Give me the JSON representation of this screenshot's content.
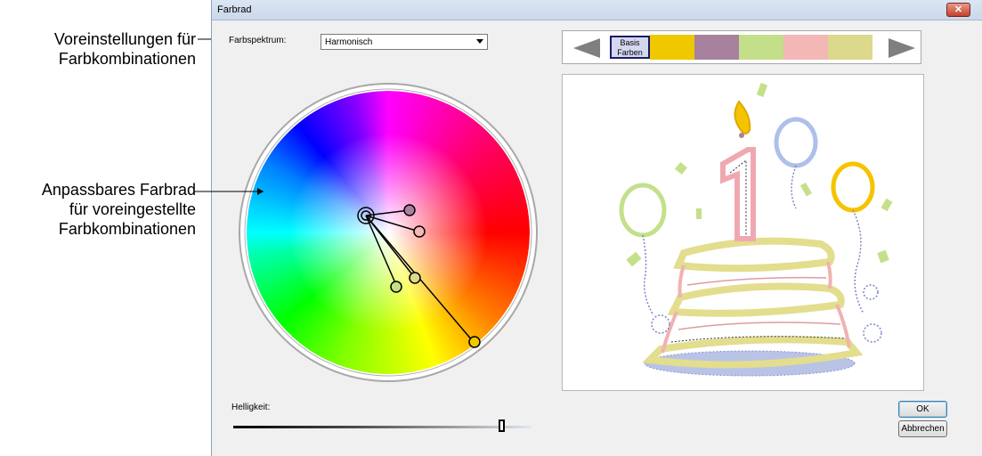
{
  "callouts": {
    "presets_line1": "Voreinstellungen für",
    "presets_line2": "Farbkombinationen",
    "wheel_line1": "Anpassbares Farbrad",
    "wheel_line2": "für voreingestellte",
    "wheel_line3": "Farbkombinationen"
  },
  "dialog": {
    "title": "Farbrad",
    "close_symbol": "✕",
    "spectrum_label": "Farbspektrum:",
    "spectrum_value": "Harmonisch",
    "brightness_label": "Helligkeit:",
    "brightness_level": 0.9,
    "ok_label": "OK",
    "cancel_label": "Abbrechen"
  },
  "swatches": {
    "basis_label": "Basis Farben",
    "colors": [
      "#efc800",
      "#a8819e",
      "#c3df8a",
      "#f3b7b5",
      "#dcd88c"
    ]
  },
  "colors": {
    "accent": "#1a1a66",
    "titlebar": "#c9d8eb"
  }
}
